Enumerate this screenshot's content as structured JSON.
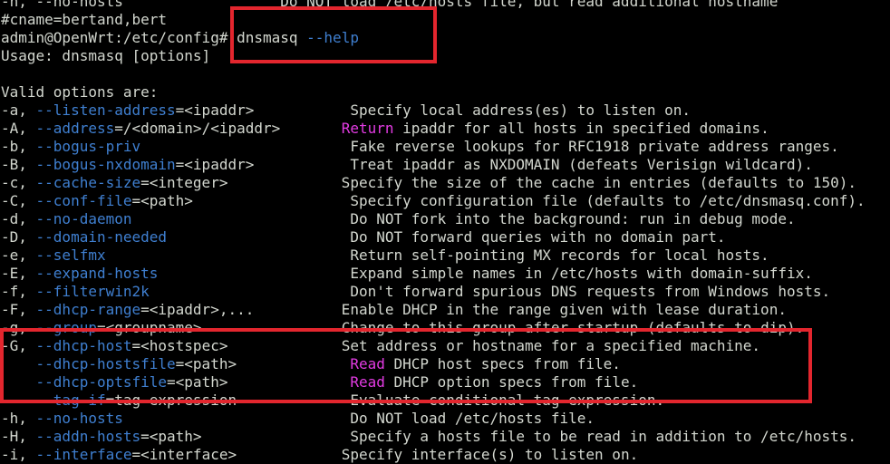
{
  "terminal": {
    "colors": {
      "background": "#000000",
      "text": "#d3d7cf",
      "flag": "#3f7fd0",
      "keyword": "#e23be2",
      "highlight_box": "#e3262e"
    },
    "lines": [
      [
        {
          "t": "-h, --no-hosts                  Do NOT load /etc/hosts file, but read additional hostname",
          "c": "text"
        }
      ],
      [
        {
          "t": "#cname=bertand,bert",
          "c": "text"
        }
      ],
      [
        {
          "t": "admin@OpenWrt:/etc/config# dnsmasq ",
          "c": "text"
        },
        {
          "t": "--help",
          "c": "flag"
        }
      ],
      [
        {
          "t": "Usage: dnsmasq [options]",
          "c": "text"
        }
      ],
      [
        {
          "t": "",
          "c": "text"
        }
      ],
      [
        {
          "t": "Valid options are:",
          "c": "text"
        }
      ],
      [
        {
          "t": "-a, ",
          "c": "text"
        },
        {
          "t": "--listen-address",
          "c": "flag"
        },
        {
          "t": "=<ipaddr>           Specify local address(es) to listen on.",
          "c": "text"
        }
      ],
      [
        {
          "t": "-A, ",
          "c": "text"
        },
        {
          "t": "--address",
          "c": "flag"
        },
        {
          "t": "=/<domain>/<ipaddr>       ",
          "c": "text"
        },
        {
          "t": "Return",
          "c": "keyword"
        },
        {
          "t": " ipaddr for all hosts in specified domains.",
          "c": "text"
        }
      ],
      [
        {
          "t": "-b, ",
          "c": "text"
        },
        {
          "t": "--bogus-priv",
          "c": "flag"
        },
        {
          "t": "                        Fake reverse lookups for RFC1918 private address ranges.",
          "c": "text"
        }
      ],
      [
        {
          "t": "-B, ",
          "c": "text"
        },
        {
          "t": "--bogus-nxdomain",
          "c": "flag"
        },
        {
          "t": "=<ipaddr>           Treat ipaddr as NXDOMAIN (defeats Verisign wildcard).",
          "c": "text"
        }
      ],
      [
        {
          "t": "-c, ",
          "c": "text"
        },
        {
          "t": "--cache-size",
          "c": "flag"
        },
        {
          "t": "=<integer>             Specify the size of the cache in entries (defaults to 150).",
          "c": "text"
        }
      ],
      [
        {
          "t": "-C, ",
          "c": "text"
        },
        {
          "t": "--conf-file",
          "c": "flag"
        },
        {
          "t": "=<path>                  Specify configuration file (defaults to /etc/dnsmasq.conf).",
          "c": "text"
        }
      ],
      [
        {
          "t": "-d, ",
          "c": "text"
        },
        {
          "t": "--no-daemon",
          "c": "flag"
        },
        {
          "t": "                         Do NOT fork into the background: run in debug mode.",
          "c": "text"
        }
      ],
      [
        {
          "t": "-D, ",
          "c": "text"
        },
        {
          "t": "--domain-needed",
          "c": "flag"
        },
        {
          "t": "                     Do NOT forward queries with no domain part.",
          "c": "text"
        }
      ],
      [
        {
          "t": "-e, ",
          "c": "text"
        },
        {
          "t": "--selfmx",
          "c": "flag"
        },
        {
          "t": "                            Return self-pointing MX records for local hosts.",
          "c": "text"
        }
      ],
      [
        {
          "t": "-E, ",
          "c": "text"
        },
        {
          "t": "--expand-hosts",
          "c": "flag"
        },
        {
          "t": "                      Expand simple names in /etc/hosts with domain-suffix.",
          "c": "text"
        }
      ],
      [
        {
          "t": "-f, ",
          "c": "text"
        },
        {
          "t": "--filterwin2k",
          "c": "flag"
        },
        {
          "t": "                       Don't forward spurious DNS requests from Windows hosts.",
          "c": "text"
        }
      ],
      [
        {
          "t": "-F, ",
          "c": "text"
        },
        {
          "t": "--dhcp-range",
          "c": "flag"
        },
        {
          "t": "=<ipaddr>,...          Enable DHCP in the range given with lease duration.",
          "c": "text"
        }
      ],
      [
        {
          "t": "-g, ",
          "c": "text"
        },
        {
          "t": "--group",
          "c": "flag"
        },
        {
          "t": "=<groupname>                Change to this group after startup (defaults to dip).",
          "c": "text"
        }
      ],
      [
        {
          "t": "-G, ",
          "c": "text"
        },
        {
          "t": "--dhcp-host",
          "c": "flag"
        },
        {
          "t": "=<hostspec>             Set address or hostname for a specified machine.",
          "c": "text"
        }
      ],
      [
        {
          "t": "    ",
          "c": "text"
        },
        {
          "t": "--dhcp-hostsfile",
          "c": "flag"
        },
        {
          "t": "=<path>             ",
          "c": "text"
        },
        {
          "t": "Read",
          "c": "keyword"
        },
        {
          "t": " DHCP host specs from file.",
          "c": "text"
        }
      ],
      [
        {
          "t": "    ",
          "c": "text"
        },
        {
          "t": "--dhcp-optsfile",
          "c": "flag"
        },
        {
          "t": "=<path>              ",
          "c": "text"
        },
        {
          "t": "Read",
          "c": "keyword"
        },
        {
          "t": " DHCP option specs from file.",
          "c": "text"
        }
      ],
      [
        {
          "t": "    ",
          "c": "text"
        },
        {
          "t": "--tag-if",
          "c": "flag"
        },
        {
          "t": "=tag-expression             Evaluate conditional tag expression.",
          "c": "text"
        }
      ],
      [
        {
          "t": "-h, ",
          "c": "text"
        },
        {
          "t": "--no-hosts",
          "c": "flag"
        },
        {
          "t": "                          Do NOT load /etc/hosts file.",
          "c": "text"
        }
      ],
      [
        {
          "t": "-H, ",
          "c": "text"
        },
        {
          "t": "--addn-hosts",
          "c": "flag"
        },
        {
          "t": "=<path>                 Specify a hosts file to be read in addition to /etc/hosts.",
          "c": "text"
        }
      ],
      [
        {
          "t": "-i, ",
          "c": "text"
        },
        {
          "t": "--interface",
          "c": "flag"
        },
        {
          "t": "=<interface>            Specify interface(s) to listen on.",
          "c": "text"
        }
      ]
    ]
  }
}
